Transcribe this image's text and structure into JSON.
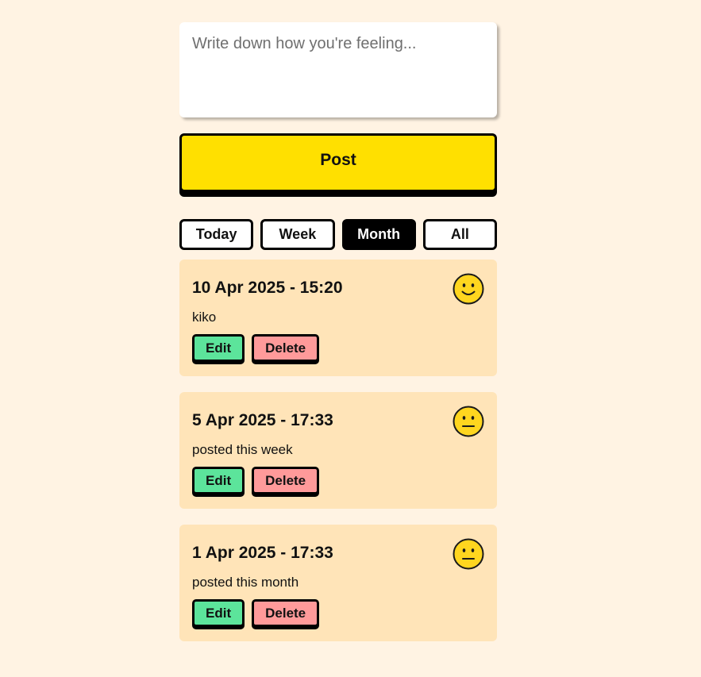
{
  "composer": {
    "placeholder": "Write down how you're feeling..."
  },
  "post_button": {
    "label": "Post"
  },
  "filters": [
    {
      "label": "Today",
      "active": false
    },
    {
      "label": "Week",
      "active": false
    },
    {
      "label": "Month",
      "active": true
    },
    {
      "label": "All",
      "active": false
    }
  ],
  "entries": [
    {
      "date": "10 Apr 2025 - 15:20",
      "text": "kiko",
      "mood": "happy-face-icon",
      "edit_label": "Edit",
      "delete_label": "Delete"
    },
    {
      "date": "5 Apr 2025 - 17:33",
      "text": "posted this week",
      "mood": "neutral-face-icon",
      "edit_label": "Edit",
      "delete_label": "Delete"
    },
    {
      "date": "1 Apr 2025 - 17:33",
      "text": "posted this month",
      "mood": "neutral-face-icon",
      "edit_label": "Edit",
      "delete_label": "Delete"
    }
  ],
  "colors": {
    "background": "#fff3e3",
    "post_button": "#ffe000",
    "entry_card": "#ffe4b8",
    "edit_button": "#5ce49b",
    "delete_button": "#ff9a9a",
    "face": "#ffd61f"
  }
}
